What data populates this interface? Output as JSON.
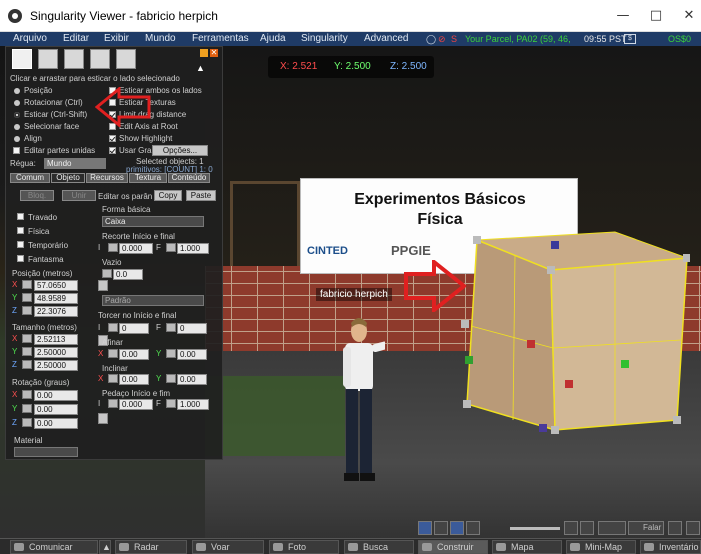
{
  "window": {
    "title": "Singularity Viewer - fabricio herpich"
  },
  "menu": {
    "items": [
      "Arquivo",
      "Editar",
      "Exibir",
      "Mundo",
      "Ferramentas",
      "Ajuda",
      "Singularity",
      "Advanced"
    ],
    "parcel": "Your Parcel, PA02 (59, 46,",
    "time": "09:55 PST",
    "money": "OS$0",
    "coin_button": "$"
  },
  "scene": {
    "coords": {
      "x": "X: 2.521",
      "y": "Y: 2.500",
      "z": "Z: 2.500"
    },
    "sign_line1": "Experimentos Básicos",
    "sign_line2": "Física",
    "logo1": "CINTED",
    "logo2": "PPGIE",
    "nametag": "fabricio herpich"
  },
  "tools": {
    "hint": "Clicar e arrastar para esticar o lado selecionado",
    "radios": [
      "Posição",
      "Rotacionar (Ctrl)",
      "Esticar (Ctrl-Shift)",
      "Selecionar face",
      "Align"
    ],
    "edit_linked": "Editar partes unidas",
    "checks_right": [
      "Esticar ambos os lados",
      "Esticar Texturas",
      "Limit drag distance",
      "Edit Axis at Root",
      "Show Highlight",
      "Usar Gra"
    ],
    "options_button": "Opções...",
    "ruler_label": "Régua:",
    "ruler_value": "Mundo",
    "selected_objects": "Selected objects: 1",
    "primitives": "primitivos: [COUNT] 1: 0",
    "tabs": [
      "Comum",
      "Objeto",
      "Recursos",
      "Textura",
      "Conteúdo"
    ],
    "lock_button": "Bloq.",
    "link_button": "Unir",
    "edit_params": "Editar os parân",
    "copy_button": "Copy",
    "paste_button": "Paste",
    "flags": [
      "Travado",
      "Física",
      "Temporário",
      "Fantasma"
    ],
    "position_label": "Posição (metros)",
    "position": {
      "x": "57.0650",
      "y": "48.9589",
      "z": "22.3076"
    },
    "size_label": "Tamanho (metros)",
    "size": {
      "x": "2.52113",
      "y": "2.50000",
      "z": "2.50000"
    },
    "rotation_label": "Rotação (graus)",
    "rotation": {
      "x": "0.00",
      "y": "0.00",
      "z": "0.00"
    },
    "material_label": "Material",
    "shape_label": "Forma básica",
    "shape_value": "Caixa",
    "path_cut_label": "Recorte Início e final",
    "path_cut": {
      "b": "0.000",
      "e": "1.000"
    },
    "hollow_label": "Vazio",
    "hollow_value": "0.0",
    "hole_value": "Padrão",
    "twist_label": "Torcer no Início e final",
    "twist": {
      "b": "0",
      "e": "0"
    },
    "taper_label": "Afinar",
    "taper": {
      "x": "0.00",
      "y": "0.00"
    },
    "shear_label": "Inclinar",
    "shear": {
      "x": "0.00",
      "y": "0.00"
    },
    "slice_label": "Pedaço Início e fim",
    "slice": {
      "b": "0.000",
      "e": "1.000"
    }
  },
  "bottom": {
    "buttons": [
      "Comunicar",
      "Radar",
      "Voar",
      "Foto",
      "Busca",
      "Construir",
      "Mapa",
      "Mini-Map",
      "Inventário"
    ],
    "talk": "Falar"
  }
}
